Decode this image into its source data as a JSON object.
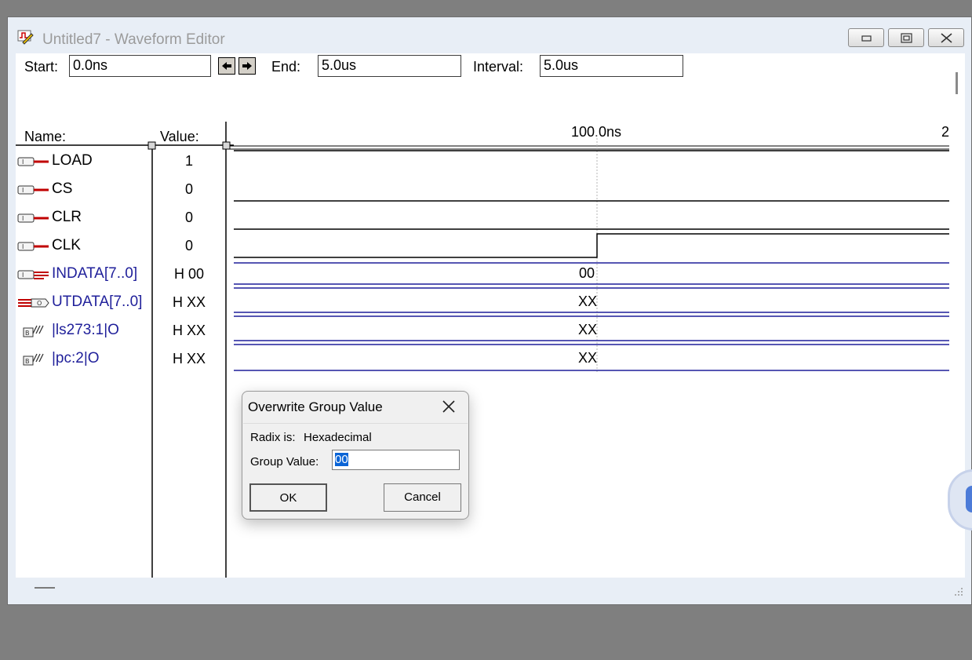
{
  "window": {
    "title": "Untitled7 - Waveform Editor"
  },
  "toolbar": {
    "start_label": "Start:",
    "start_value": "0.0ns",
    "end_label": "End:",
    "end_value": "5.0us",
    "interval_label": "Interval:",
    "interval_value": "5.0us"
  },
  "headers": {
    "name": "Name:",
    "value": "Value:"
  },
  "timeline": {
    "marker_label": "100.0ns",
    "edge_label": "2"
  },
  "signals": [
    {
      "name": "LOAD",
      "value": "1",
      "type": "input",
      "color": "#000000"
    },
    {
      "name": "CS",
      "value": "0",
      "type": "input",
      "color": "#000000"
    },
    {
      "name": "CLR",
      "value": "0",
      "type": "input",
      "color": "#000000"
    },
    {
      "name": "CLK",
      "value": "0",
      "type": "input",
      "color": "#000000"
    },
    {
      "name": "INDATA[7..0]",
      "value": "H 00",
      "type": "input-group",
      "color": "#1f1f9a",
      "bus_label": "00"
    },
    {
      "name": "UTDATA[7..0]",
      "value": "H XX",
      "type": "output-group",
      "color": "#1f1f9a",
      "bus_label": "XX"
    },
    {
      "name": "|ls273:1|O",
      "value": "H XX",
      "type": "buried",
      "color": "#1f1f9a",
      "bus_label": "XX"
    },
    {
      "name": "|pc:2|O",
      "value": "H XX",
      "type": "buried",
      "color": "#1f1f9a",
      "bus_label": "XX"
    }
  ],
  "dialog": {
    "title": "Overwrite Group Value",
    "radix_label": "Radix is:",
    "radix_value": "Hexadecimal",
    "group_label": "Group Value:",
    "group_value": "00",
    "ok_label": "OK",
    "cancel_label": "Cancel"
  },
  "colors": {
    "bus": "#1f1f9a",
    "input_icon": "#c00000"
  }
}
